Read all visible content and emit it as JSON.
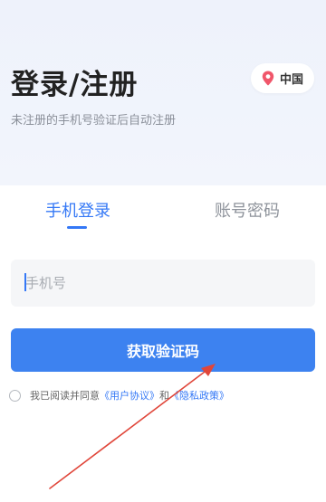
{
  "header": {
    "title": "登录/注册",
    "subtitle": "未注册的手机号验证后自动注册",
    "region": {
      "label": "中国",
      "icon": "location-pin-icon"
    }
  },
  "tabs": [
    {
      "label": "手机登录",
      "active": true
    },
    {
      "label": "账号密码",
      "active": false
    }
  ],
  "form": {
    "phone_placeholder": "手机号",
    "phone_value": "",
    "submit_label": "获取验证码"
  },
  "agreement": {
    "checked": false,
    "prefix": "我已阅读并同意",
    "user_agreement": "《用户协议》",
    "conjunction": "和",
    "privacy_policy": "《隐私政策》"
  },
  "colors": {
    "accent": "#3478f6",
    "button": "#3d82f0",
    "hero_background": "#eef2fb",
    "location_pin": "#f0566a",
    "annotation_arrow": "#e0463a"
  }
}
